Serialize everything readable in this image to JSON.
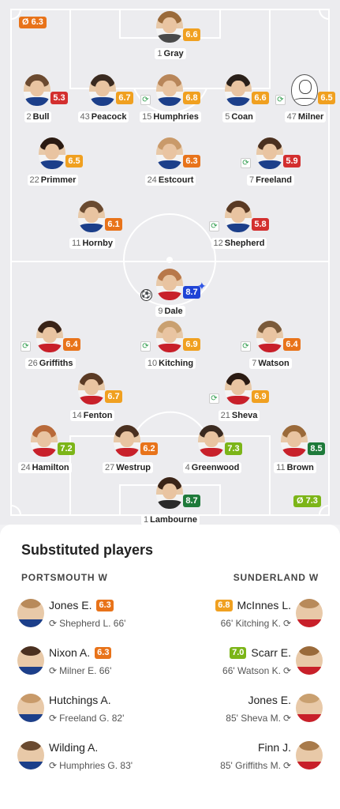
{
  "colors": {
    "red": "#d32f2f",
    "orange": "#e8731a",
    "amber": "#f0a020",
    "lightgreen": "#7cb518",
    "green": "#1e7a3a",
    "blue": "#1f44d6"
  },
  "avg_top": {
    "symbol": "Ø",
    "value": "6.3"
  },
  "avg_bottom": {
    "symbol": "Ø",
    "value": "7.3"
  },
  "players": [
    {
      "num": "1",
      "name": "Gray",
      "rating": "6.6",
      "color": "amber",
      "hair": "#9a6a3a",
      "shirt": "#4a4a4a"
    },
    {
      "num": "2",
      "name": "Bull",
      "rating": "5.3",
      "color": "red",
      "hair": "#6b4a30",
      "shirt": "#1c3f8a"
    },
    {
      "num": "43",
      "name": "Peacock",
      "rating": "6.7",
      "color": "amber",
      "hair": "#3a2a20",
      "shirt": "#1c3f8a"
    },
    {
      "num": "15",
      "name": "Humphries",
      "rating": "6.8",
      "color": "amber",
      "hair": "#b8865a",
      "shirt": "#1c3f8a",
      "sub": true
    },
    {
      "num": "5",
      "name": "Coan",
      "rating": "6.6",
      "color": "amber",
      "hair": "#2a201a",
      "shirt": "#1c3f8a"
    },
    {
      "num": "47",
      "name": "Milner",
      "rating": "6.5",
      "color": "amber",
      "silhouette": true,
      "sub": true
    },
    {
      "num": "22",
      "name": "Primmer",
      "rating": "6.5",
      "color": "amber",
      "hair": "#2a1a12",
      "shirt": "#1c3f8a"
    },
    {
      "num": "24",
      "name": "Estcourt",
      "rating": "6.3",
      "color": "orange",
      "hair": "#c99a6a",
      "shirt": "#1c3f8a"
    },
    {
      "num": "7",
      "name": "Freeland",
      "rating": "5.9",
      "color": "red",
      "hair": "#4a3020",
      "shirt": "#1c3f8a",
      "sub": true
    },
    {
      "num": "11",
      "name": "Hornby",
      "rating": "6.1",
      "color": "orange",
      "hair": "#6a4a30",
      "shirt": "#1c3f8a"
    },
    {
      "num": "12",
      "name": "Shepherd",
      "rating": "5.8",
      "color": "red",
      "hair": "#5a3a24",
      "shirt": "#1c3f8a",
      "sub": true
    },
    {
      "num": "9",
      "name": "Dale",
      "rating": "8.7",
      "color": "blue",
      "hair": "#b8784a",
      "shirt": "#c8202a",
      "goal": true,
      "star": true
    },
    {
      "num": "26",
      "name": "Griffiths",
      "rating": "6.4",
      "color": "orange",
      "hair": "#3a2418",
      "shirt": "#c8202a",
      "sub": true
    },
    {
      "num": "10",
      "name": "Kitching",
      "rating": "6.9",
      "color": "amber",
      "hair": "#c9a070",
      "shirt": "#c8202a",
      "sub": true
    },
    {
      "num": "7",
      "name": "Watson",
      "rating": "6.4",
      "color": "orange",
      "hair": "#7a5a3a",
      "shirt": "#c8202a",
      "sub": true
    },
    {
      "num": "14",
      "name": "Fenton",
      "rating": "6.7",
      "color": "amber",
      "hair": "#5a3a24",
      "shirt": "#c8202a"
    },
    {
      "num": "21",
      "name": "Sheva",
      "rating": "6.9",
      "color": "amber",
      "hair": "#2a1a12",
      "shirt": "#c8202a",
      "sub": true
    },
    {
      "num": "24",
      "name": "Hamilton",
      "rating": "7.2",
      "color": "lightgreen",
      "hair": "#b86a3a",
      "shirt": "#c8202a"
    },
    {
      "num": "27",
      "name": "Westrup",
      "rating": "6.2",
      "color": "orange",
      "hair": "#4a3020",
      "shirt": "#c8202a"
    },
    {
      "num": "4",
      "name": "Greenwood",
      "rating": "7.3",
      "color": "lightgreen",
      "hair": "#3a2a20",
      "shirt": "#c8202a"
    },
    {
      "num": "11",
      "name": "Brown",
      "rating": "8.5",
      "color": "green",
      "hair": "#9a6a3a",
      "shirt": "#c8202a"
    },
    {
      "num": "1",
      "name": "Lambourne",
      "rating": "8.7",
      "color": "green",
      "hair": "#3a2418",
      "shirt": "#2a2a2a"
    }
  ],
  "subs": {
    "title": "Substituted players",
    "home_team": "PORTSMOUTH W",
    "away_team": "SUNDERLAND W",
    "home": [
      {
        "name": "Jones E.",
        "rating": "6.3",
        "color": "orange",
        "replaced": "Shepherd L. 66'",
        "shirt": "#1c3f8a",
        "hair": "#b88a5a"
      },
      {
        "name": "Nixon A.",
        "rating": "6.3",
        "color": "orange",
        "replaced": "Milner E. 66'",
        "shirt": "#1c3f8a",
        "hair": "#4a3020"
      },
      {
        "name": "Hutchings A.",
        "rating": "",
        "color": "",
        "replaced": "Freeland G. 82'",
        "shirt": "#1c3f8a",
        "hair": "#c89a6a"
      },
      {
        "name": "Wilding A.",
        "rating": "",
        "color": "",
        "replaced": "Humphries G. 83'",
        "shirt": "#1c3f8a",
        "hair": "#6a4a30"
      }
    ],
    "away": [
      {
        "name": "McInnes L.",
        "rating": "6.8",
        "color": "amber",
        "replaced": "66' Kitching K.",
        "shirt": "#c8202a",
        "hair": "#b88a5a"
      },
      {
        "name": "Scarr E.",
        "rating": "7.0",
        "color": "lightgreen",
        "replaced": "66' Watson K.",
        "shirt": "#c8202a",
        "hair": "#9a6a3a"
      },
      {
        "name": "Jones E.",
        "rating": "",
        "color": "",
        "replaced": "85' Sheva M.",
        "shirt": "#c8202a",
        "hair": "#c9a070"
      },
      {
        "name": "Finn J.",
        "rating": "",
        "color": "",
        "replaced": "85' Griffiths M.",
        "shirt": "#c8202a",
        "hair": "#a87a4a"
      }
    ]
  }
}
